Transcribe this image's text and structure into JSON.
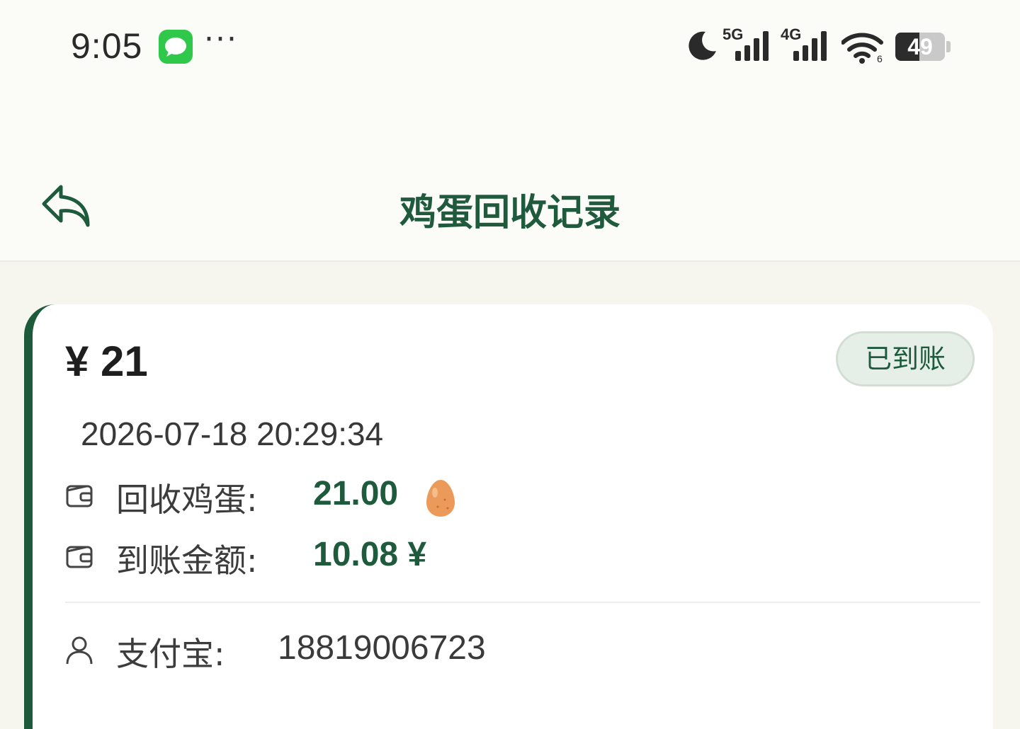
{
  "status_bar": {
    "time": "9:05",
    "sim1_label": "5G",
    "sim2_label": "4G",
    "battery_percent": "49",
    "battery_level": 0.49,
    "icons": [
      "messages-icon",
      "more-dots-icon",
      "moon-icon",
      "signal-icon",
      "wifi-icon",
      "battery-icon"
    ]
  },
  "header": {
    "title": "鸡蛋回收记录",
    "back_icon": "back-arrow-icon"
  },
  "record": {
    "amount": "¥ 21",
    "status": "已到账",
    "datetime": "2026-07-18 20:29:34",
    "eggs_label": "回收鸡蛋:",
    "eggs_value": "21.00",
    "payout_label": "到账金额:",
    "payout_value": "10.08 ¥",
    "alipay_label": "支付宝:",
    "alipay_value": "18819006723"
  },
  "colors": {
    "accent": "#1e5a3c",
    "background": "#f6f6ee",
    "badge_bg": "#e6eee8"
  }
}
